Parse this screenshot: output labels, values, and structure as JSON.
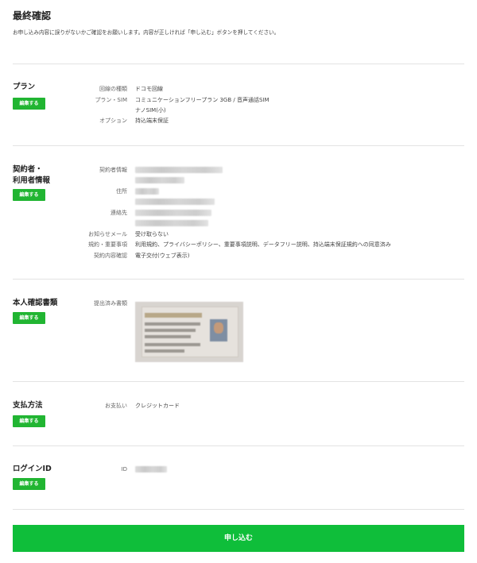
{
  "page": {
    "title": "最終確認",
    "description": "お申し込み内容に誤りがないかご確認をお願いします。内容が正しければ「申し込む」ボタンを押してください。"
  },
  "edit_label": "編集する",
  "plan": {
    "title": "プラン",
    "line_type_label": "回線の種類",
    "line_type_value": "ドコモ回線",
    "plan_sim_label": "プラン・SIM",
    "plan_value": "コミュニケーションフリープラン 3GB / 音声通話SIM",
    "sim_size_value": "ナノSIM(小)",
    "option_label": "オプション",
    "option_value": "持込端末保証"
  },
  "contract": {
    "title_line1": "契約者・",
    "title_line2": "利用者情報",
    "holder_label": "契約者情報",
    "address_label": "住所",
    "contact_label": "連絡先",
    "mail_label": "お知らせメール",
    "mail_value": "受け取らない",
    "terms_label": "規約・重要事項",
    "terms_value": "利用規約、プライバシーポリシー、重要事項説明、データフリー説明、持込端末保証規約への同意済み",
    "confirm_label": "契約内容確認",
    "confirm_value": "電子交付(ウェブ表示)"
  },
  "identity": {
    "title": "本人確認書類",
    "submitted_label": "提出済み書類"
  },
  "payment": {
    "title": "支払方法",
    "payment_label": "お支払い",
    "payment_value": "クレジットカード"
  },
  "login": {
    "title": "ログインID",
    "id_label": "ID"
  },
  "submit_label": "申し込む",
  "colors": {
    "accent_green": "#0fbe3a",
    "edit_button_green": "#21b532"
  }
}
